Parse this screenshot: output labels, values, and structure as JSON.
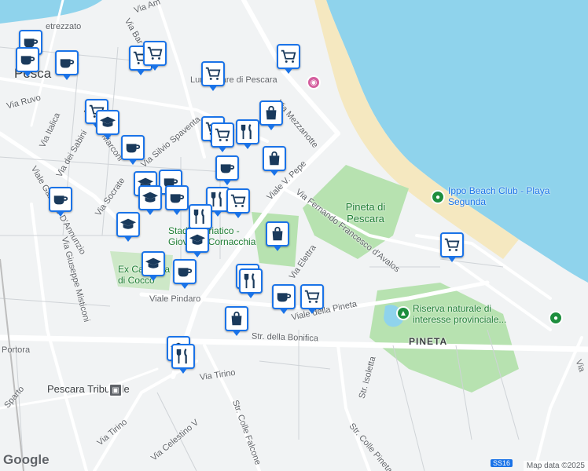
{
  "map": {
    "streets": [
      {
        "key": "s1",
        "text": "Via Am"
      },
      {
        "key": "s2",
        "text": "etrezzato"
      },
      {
        "key": "s3",
        "text": "Via Bar"
      },
      {
        "key": "s4",
        "text": "Pesca"
      },
      {
        "key": "s5",
        "text": "Lungomare di Pescara"
      },
      {
        "key": "s6",
        "text": "Via Ruvo"
      },
      {
        "key": "s7",
        "text": "Via Italica"
      },
      {
        "key": "s8",
        "text": "Viale G. Marconi"
      },
      {
        "key": "s9",
        "text": "Via Silvio Spaventa"
      },
      {
        "key": "s10",
        "text": "Via dei Sabini"
      },
      {
        "key": "s11",
        "text": "Via Mezzanotte"
      },
      {
        "key": "s12",
        "text": "Viale Gabriele D'Annunzio"
      },
      {
        "key": "s13",
        "text": "Via Socrate"
      },
      {
        "key": "s14",
        "text": "Viale V. Pepe"
      },
      {
        "key": "s15",
        "text": "Via Fernando Francesco d'Avalos"
      },
      {
        "key": "s16",
        "text": "Via Giuseppe Misticoni"
      },
      {
        "key": "s17",
        "text": "Via Elettra"
      },
      {
        "key": "s18",
        "text": "Viale Pindaro"
      },
      {
        "key": "s19",
        "text": "Viale della Pineta"
      },
      {
        "key": "s20",
        "text": "Str. della Bonifica"
      },
      {
        "key": "s21",
        "text": "Via Tirino"
      },
      {
        "key": "s22",
        "text": "Via Tirino"
      },
      {
        "key": "s23",
        "text": "Via Celestino V"
      },
      {
        "key": "s24",
        "text": "Str. Colle Falcone"
      },
      {
        "key": "s25",
        "text": "Str. Isoletta"
      },
      {
        "key": "s26",
        "text": "Str. Colle Pineta"
      },
      {
        "key": "s27",
        "text": "Portora"
      },
      {
        "key": "s28",
        "text": "Sparto"
      },
      {
        "key": "s29",
        "text": "Via"
      }
    ],
    "places": {
      "pineta_park": "Pineta di Pescara",
      "ippo_beach": "Ippo Beach Club - Playa Segunda",
      "riserva": "Riserva naturale di interesse provinciale...",
      "pineta_district": "PINETA",
      "stadio": "Stadio Adriatico - Giovanni Cornacchia",
      "ex_caserma": "Ex Caserma di Cocco",
      "tribunale": "Pescara Tribunale",
      "lungomare_poi": "Lungomare di Pescara"
    },
    "markers": [
      {
        "id": "m1",
        "icon": "coffee-icon"
      },
      {
        "id": "m2",
        "icon": "coffee-icon"
      },
      {
        "id": "m3",
        "icon": "coffee-icon"
      },
      {
        "id": "m4",
        "icon": "cart-icon"
      },
      {
        "id": "m5",
        "icon": "cart-icon"
      },
      {
        "id": "m6",
        "icon": "cart-icon"
      },
      {
        "id": "m7",
        "icon": "school-icon"
      },
      {
        "id": "m8",
        "icon": "cart-icon"
      },
      {
        "id": "m9",
        "icon": "cart-icon"
      },
      {
        "id": "m10",
        "icon": "bag-icon"
      },
      {
        "id": "m11",
        "icon": "cart-icon"
      },
      {
        "id": "m12",
        "icon": "cart-icon"
      },
      {
        "id": "m13",
        "icon": "restaurant-icon"
      },
      {
        "id": "m14",
        "icon": "bag-icon"
      },
      {
        "id": "m15",
        "icon": "coffee-icon"
      },
      {
        "id": "m16",
        "icon": "coffee-icon"
      },
      {
        "id": "m17",
        "icon": "school-icon"
      },
      {
        "id": "m18",
        "icon": "coffee-icon"
      },
      {
        "id": "m19",
        "icon": "restaurant-icon"
      },
      {
        "id": "m20",
        "icon": "cart-icon"
      },
      {
        "id": "m21",
        "icon": "coffee-icon"
      },
      {
        "id": "m22",
        "icon": "school-icon"
      },
      {
        "id": "m23",
        "icon": "restaurant-icon"
      },
      {
        "id": "m24",
        "icon": "school-icon"
      },
      {
        "id": "m25",
        "icon": "bag-icon"
      },
      {
        "id": "m26",
        "icon": "school-icon"
      },
      {
        "id": "m27",
        "icon": "coffee-icon"
      },
      {
        "id": "m28",
        "icon": "restaurant-icon"
      },
      {
        "id": "m29",
        "icon": "coffee-icon"
      },
      {
        "id": "m30",
        "icon": "restaurant-icon"
      },
      {
        "id": "m31",
        "icon": "bag-icon"
      },
      {
        "id": "m32",
        "icon": "school-icon"
      },
      {
        "id": "m33",
        "icon": "school-icon"
      },
      {
        "id": "m34",
        "icon": "restaurant-icon"
      },
      {
        "id": "m35",
        "icon": "cart-icon"
      },
      {
        "id": "m36",
        "icon": "coffee-icon"
      },
      {
        "id": "m37",
        "icon": "cart-icon"
      }
    ],
    "colors": {
      "sea": "#8fd3ec",
      "beach": "#f5e8c0",
      "park": "#b7e2b0",
      "road": "#ffffff",
      "land": "#f1f3f4",
      "marker": "#1a73e8"
    },
    "route_badge": "SS16",
    "attribution": "Map data ©2025",
    "logo": "Google"
  }
}
